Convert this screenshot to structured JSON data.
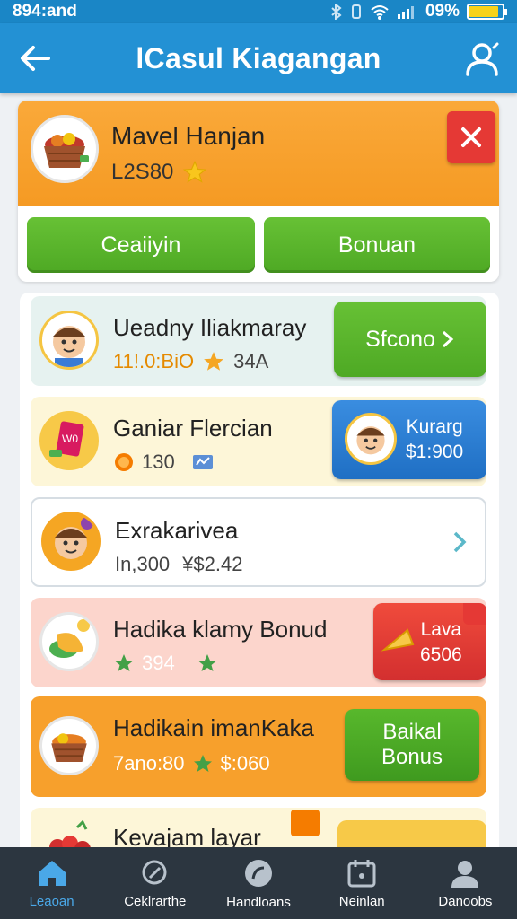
{
  "status_bar": {
    "time": "894:and",
    "battery": "09%",
    "battery_level": 0.85
  },
  "header": {
    "title": "lCasul Kiagangan"
  },
  "profile": {
    "name": "Mavel Hanjan",
    "points": "L2S80",
    "buttons": [
      "Ceaiiyin",
      "Bonuan"
    ]
  },
  "list": [
    {
      "title": "Ueadny Iliakmaray",
      "meta1": "11!.0:BiO",
      "meta2": "34A",
      "action": "Sfcono",
      "color": "#e6f2f0"
    },
    {
      "title": "Ganiar Flercian",
      "meta1": "130",
      "meta2": "",
      "action_title": "Kurarg",
      "action_amount": "$1:900",
      "color": "#fdf6d8"
    },
    {
      "title": "Exrakarivea",
      "meta1": "In,300",
      "meta2": "¥$2.42",
      "color": "#ffffff"
    },
    {
      "title": "Hadika klamy Bonud",
      "meta1": "394",
      "meta2": "",
      "action_title": "Lava",
      "action_amount": "6506",
      "color": "#fcd5cc"
    },
    {
      "title": "Hadikain imanKaka",
      "meta1": "7ano:80",
      "meta2": "$:060",
      "action_title": "Baikal",
      "action_sub": "Bonus",
      "color": "#f7a02c"
    },
    {
      "title": "Kevajam layar",
      "color": "#fdf6d8"
    }
  ],
  "nav": [
    {
      "label": "Leaoan",
      "icon": "home-icon",
      "active": true
    },
    {
      "label": "Ceklrarthe",
      "icon": "search-icon",
      "active": false
    },
    {
      "label": "Handloans",
      "icon": "chat-icon",
      "active": false
    },
    {
      "label": "Neinlan",
      "icon": "calendar-icon",
      "active": false
    },
    {
      "label": "Danoobs",
      "icon": "user-icon",
      "active": false
    }
  ]
}
